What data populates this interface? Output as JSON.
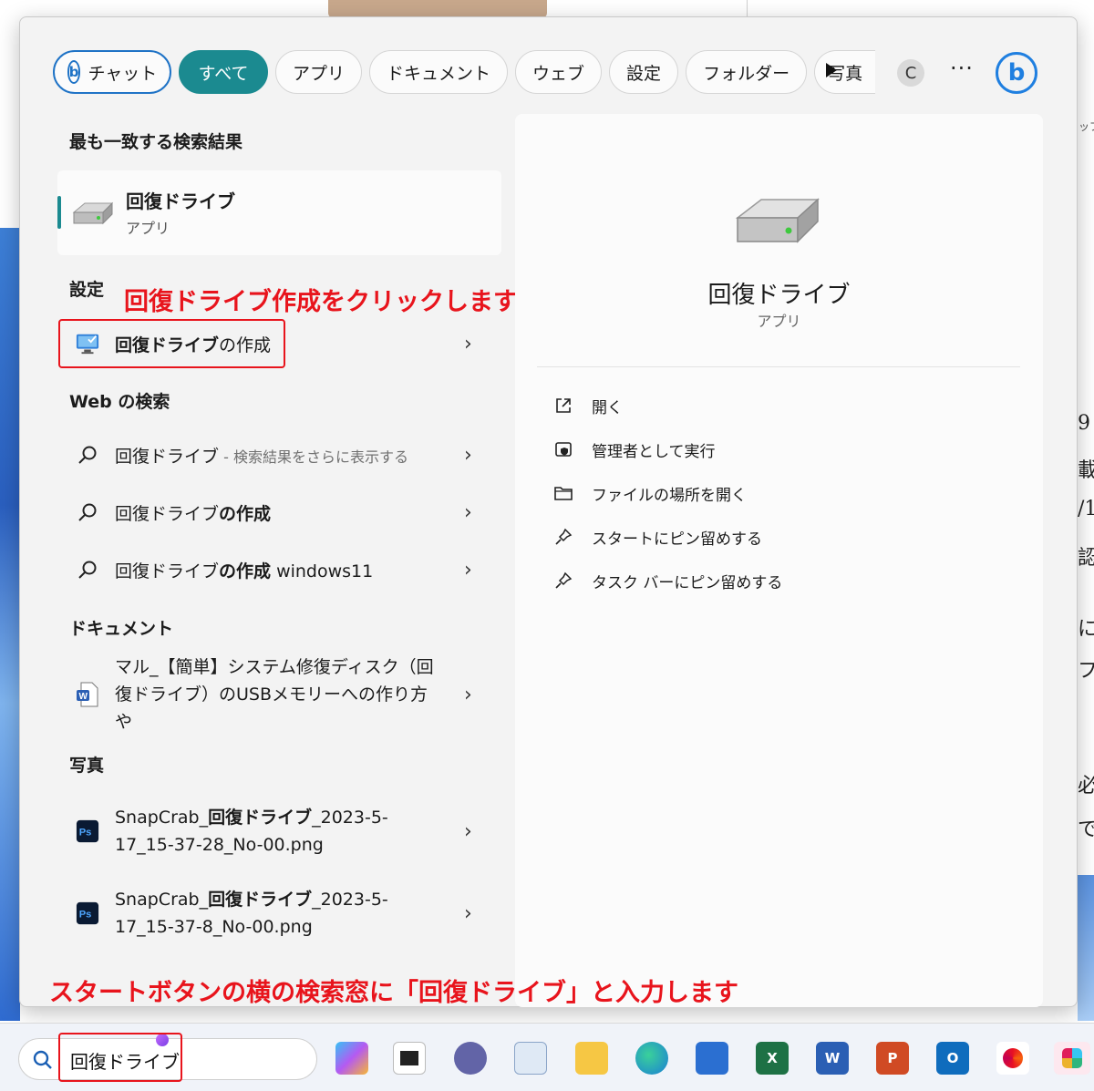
{
  "background": {
    "right_glyphs": [
      "9",
      "載",
      "/1",
      "認",
      "に",
      "フ",
      "必",
      "で"
    ],
    "right_hint": "ップ"
  },
  "filters": {
    "chat": "チャット",
    "tabs": [
      "すべて",
      "アプリ",
      "ドキュメント",
      "ウェブ",
      "設定",
      "フォルダー",
      "写真"
    ],
    "avatar_initial": "C",
    "more": "···"
  },
  "best_match": {
    "heading": "最も一致する検索結果",
    "title": "回復ドライブ",
    "subtitle": "アプリ"
  },
  "settings": {
    "heading": "設定",
    "item_bold": "回復ドライブ",
    "item_rest": "の作成"
  },
  "web": {
    "heading": "Web の検索",
    "items": [
      {
        "plain": "回復ドライブ",
        "bold": "",
        "muted": " - 検索結果をさらに表示する"
      },
      {
        "plain": "回復ドライブ",
        "bold": "の作成",
        "muted": ""
      },
      {
        "plain": "回復ドライブ",
        "bold": "の作成",
        "tail": " windows11",
        "muted": ""
      }
    ]
  },
  "documents": {
    "heading": "ドキュメント",
    "item": "マル_【簡単】システム修復ディスク（回復ドライブ）のUSBメモリーへの作り方や"
  },
  "photos": {
    "heading": "写真",
    "items": [
      {
        "prefix": "SnapCrab_",
        "bold": "回復ドライブ",
        "suffix": "_2023-5-17_15-37-28_No-00.png"
      },
      {
        "prefix": "SnapCrab_",
        "bold": "回復ドライブ",
        "suffix": "_2023-5-17_15-37-8_No-00.png"
      }
    ]
  },
  "preview": {
    "title": "回復ドライブ",
    "subtitle": "アプリ",
    "actions": [
      "開く",
      "管理者として実行",
      "ファイルの場所を開く",
      "スタートにピン留めする",
      "タスク バーにピン留めする"
    ]
  },
  "annotations": {
    "top": "回復ドライブ作成をクリックします",
    "bottom": "スタートボタンの横の検索窓に「回復ドライブ」と入力します"
  },
  "taskbar": {
    "search_value": "回復ドライブ",
    "apps": [
      "copilot-pre",
      "desktop",
      "teams",
      "monitor",
      "file-explorer",
      "edge",
      "store",
      "excel",
      "word",
      "powerpoint",
      "outlook",
      "photos",
      "slack"
    ]
  }
}
